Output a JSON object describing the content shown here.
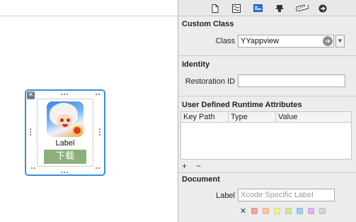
{
  "canvas": {
    "cell": {
      "label": "Label",
      "button": "下载"
    }
  },
  "inspector": {
    "toolbar_icons": [
      "file-inspector-icon",
      "quick-help-icon",
      "identity-inspector-icon",
      "attributes-inspector-icon",
      "size-inspector-icon",
      "connections-inspector-icon"
    ],
    "custom_class": {
      "title": "Custom Class",
      "class_label": "Class",
      "class_value": "YYappview"
    },
    "identity": {
      "title": "Identity",
      "restoration_label": "Restoration ID",
      "restoration_value": ""
    },
    "runtime_attributes": {
      "title": "User Defined Runtime Attributes",
      "columns": [
        "Key Path",
        "Type",
        "Value"
      ],
      "add_label": "+",
      "remove_label": "−"
    },
    "document": {
      "title": "Document",
      "label_label": "Label",
      "label_placeholder": "Xcode Specific Label",
      "clear_label": "✕",
      "colors": [
        "#f2a6a0",
        "#f6c89a",
        "#f3ef9a",
        "#c9eaa4",
        "#a9cdf4",
        "#e2b5ef",
        "#d4d4d4"
      ]
    }
  }
}
